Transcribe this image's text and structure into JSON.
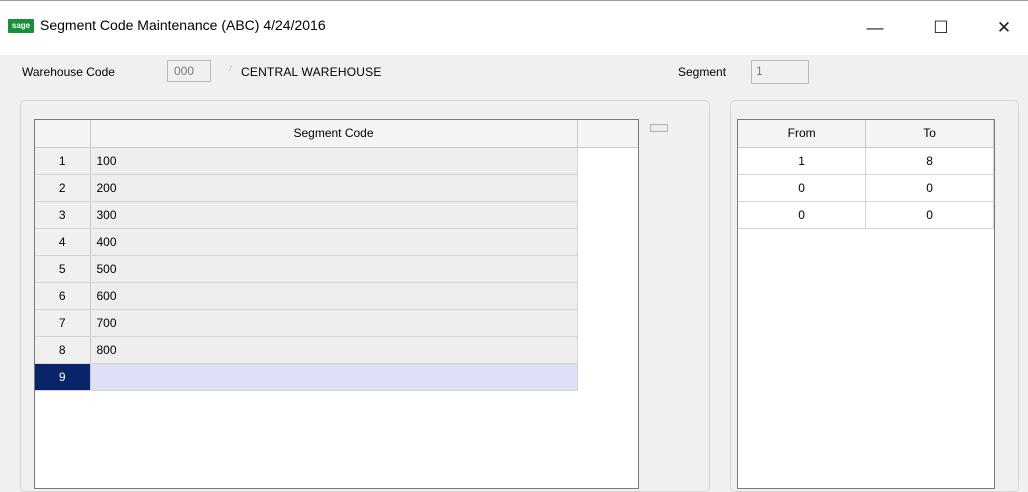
{
  "window": {
    "logo": "sage",
    "title": "Segment Code Maintenance (ABC) 4/24/2016",
    "minimize_glyph": "—",
    "maximize_glyph": "☐",
    "close_glyph": "✕"
  },
  "header": {
    "warehouse_label": "Warehouse Code",
    "warehouse_code": "000",
    "warehouse_desc": "CENTRAL WAREHOUSE",
    "segment_label": "Segment",
    "segment_value": "1"
  },
  "segment_grid": {
    "column_header": "Segment Code",
    "rows": [
      {
        "num": "1",
        "code": "100"
      },
      {
        "num": "2",
        "code": "200"
      },
      {
        "num": "3",
        "code": "300"
      },
      {
        "num": "4",
        "code": "400"
      },
      {
        "num": "5",
        "code": "500"
      },
      {
        "num": "6",
        "code": "600"
      },
      {
        "num": "7",
        "code": "700"
      },
      {
        "num": "8",
        "code": "800"
      },
      {
        "num": "9",
        "code": ""
      }
    ],
    "selected_row": "9"
  },
  "range_grid": {
    "from_header": "From",
    "to_header": "To",
    "rows": [
      {
        "from": "1",
        "to": "8"
      },
      {
        "from": "0",
        "to": "0"
      },
      {
        "from": "0",
        "to": "0"
      }
    ]
  },
  "colors": {
    "selected_row_number": "#0a246a",
    "selected_row_cell": "#dfdff7",
    "logo_green": "#1a8f3a"
  }
}
